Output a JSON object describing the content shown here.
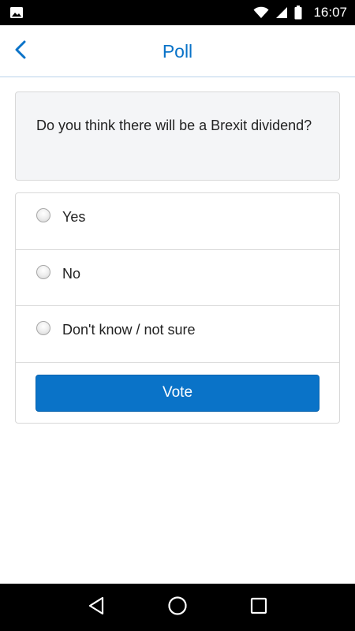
{
  "status_bar": {
    "time": "16:07",
    "icons": [
      "image-icon",
      "wifi-icon",
      "cell-signal-icon",
      "battery-icon"
    ]
  },
  "header": {
    "title": "Poll",
    "back_icon": "chevron-left-icon"
  },
  "poll": {
    "question": "Do you think there will be a Brexit dividend?",
    "options": [
      {
        "label": "Yes",
        "selected": false
      },
      {
        "label": "No",
        "selected": false
      },
      {
        "label": "Don't know / not sure",
        "selected": false
      }
    ],
    "vote_label": "Vote"
  },
  "nav_bar": {
    "icons": [
      "back-triangle-icon",
      "home-circle-icon",
      "recents-square-icon"
    ]
  },
  "colors": {
    "accent": "#0a73c8",
    "status_bar": "#000000",
    "card_background": "#f4f5f7"
  }
}
